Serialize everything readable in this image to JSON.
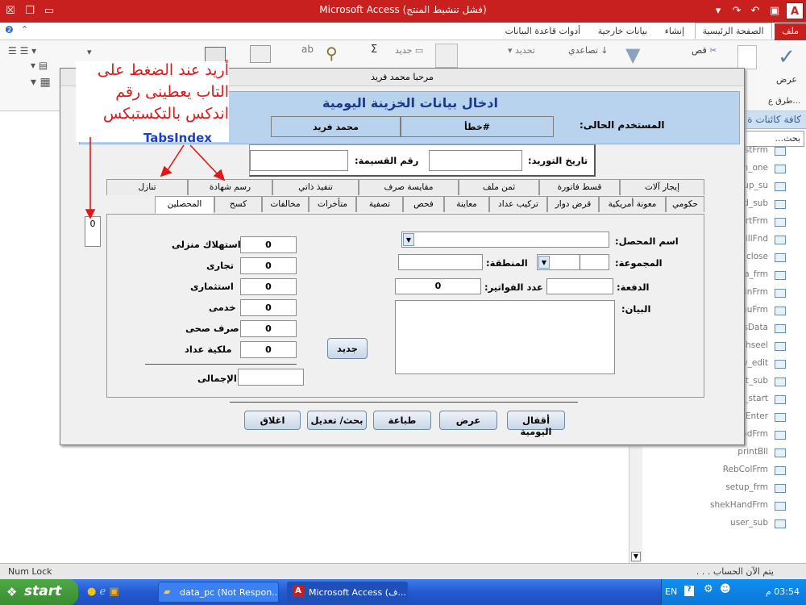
{
  "app": {
    "title": "Microsoft Access (فشل تنشيط المنتج)",
    "icon_letter": "A"
  },
  "ribbon": {
    "tabs": [
      {
        "label": "ملف"
      },
      {
        "label": "الصفحة الرئيسية"
      },
      {
        "label": "إنشاء"
      },
      {
        "label": "بيانات خارجية"
      },
      {
        "label": "أدوات قاعدة البيانات"
      }
    ],
    "view_label": "عرض",
    "views_group": "طرق ع...",
    "cut": "قص",
    "sort_asc": "تصاعدي",
    "filter": "تحديد",
    "new": "جديد",
    "sum": "Σ"
  },
  "nav": {
    "header": "كافة كائنات ة",
    "search": "بحث...",
    "items": [
      {
        "label": "FirstFrm"
      },
      {
        "label": "frm_one"
      },
      {
        "label": "group_su"
      },
      {
        "label": "lled_sub"
      },
      {
        "label": "ReportFrm"
      },
      {
        "label": "lzBillFnd"
      },
      {
        "label": "la_close"
      },
      {
        "label": "ma_frm"
      },
      {
        "label": "loginFrm"
      },
      {
        "label": "MenuFrm"
      },
      {
        "label": "ansData"
      },
      {
        "label": "aThseel"
      },
      {
        "label": "ew_edit"
      },
      {
        "label": "edit_sub"
      },
      {
        "label": "w_start"
      },
      {
        "label": "ataEnter"
      },
      {
        "label": "PnodFrm"
      },
      {
        "label": "printBll"
      },
      {
        "label": "RebColFrm"
      },
      {
        "label": "setup_frm"
      },
      {
        "label": "shekHandFrm"
      },
      {
        "label": "user_sub"
      }
    ]
  },
  "statusbar": {
    "left": "Num Lock",
    "right": "يتم الآن الحساب . . ."
  },
  "taskbar": {
    "start": "start",
    "tasks": [
      {
        "label": "data_pc (Not Respon..."
      },
      {
        "label": "Microsoft Access (ف..."
      }
    ],
    "lang": "EN",
    "time": "03:54 م"
  },
  "annotation": {
    "text": "أريد عند الضغط على التاب يعطينى رقم اندكس بالتكستبكس",
    "tabs_index": "TabsIndex",
    "index_value": "0"
  },
  "form": {
    "caption": "مرحبا محمد فريد",
    "title": "ادخال بيانات الخزينة اليومية",
    "current_user_label": "المستخدم الحالى:",
    "error_value": "#خطأ",
    "user_name": "محمد فريد",
    "supply_date_label": "تاريخ التوريد:",
    "slip_number_label": "رقم القسيمة:",
    "tabs_row1": [
      {
        "label": "إيجار آلات"
      },
      {
        "label": "قسط فاتورة"
      },
      {
        "label": "ثمن ملف"
      },
      {
        "label": "مقايسة صرف"
      },
      {
        "label": "تنفيذ ذاتي"
      },
      {
        "label": "رسم شهادة"
      },
      {
        "label": "تنازل"
      }
    ],
    "tabs_row2": [
      {
        "label": "حكومي"
      },
      {
        "label": "معونة أمريكية"
      },
      {
        "label": "قرض دوار"
      },
      {
        "label": "تركيب عداد"
      },
      {
        "label": "معاينة"
      },
      {
        "label": "فحص"
      },
      {
        "label": "تصفية"
      },
      {
        "label": "متأخرات"
      },
      {
        "label": "مخالفات"
      },
      {
        "label": "كسح"
      },
      {
        "label": "المحصلين"
      }
    ],
    "collector_label": "اسم المحصل:",
    "group_label": "المجموعة:",
    "region_label": "المنطقة:",
    "batch_label": "الدفعة:",
    "invoices_label": "عدد الفواتير:",
    "invoices_value": "0",
    "statement_label": "البيان:",
    "fees": [
      {
        "label": "استهلاك منزلى",
        "value": "0"
      },
      {
        "label": "تجارى",
        "value": "0"
      },
      {
        "label": "استثمارى",
        "value": "0"
      },
      {
        "label": "خدمى",
        "value": "0"
      },
      {
        "label": "صرف صحى",
        "value": "0"
      },
      {
        "label": "ملكية عداد",
        "value": "0"
      }
    ],
    "total_label": "الإجمالى",
    "new_button": "جديد",
    "buttons": {
      "close_day": "أقفال اليومية",
      "view": "عرض",
      "print": "طباعة",
      "search_edit": "بحث/ تعديل",
      "close": "اغلاق"
    }
  }
}
